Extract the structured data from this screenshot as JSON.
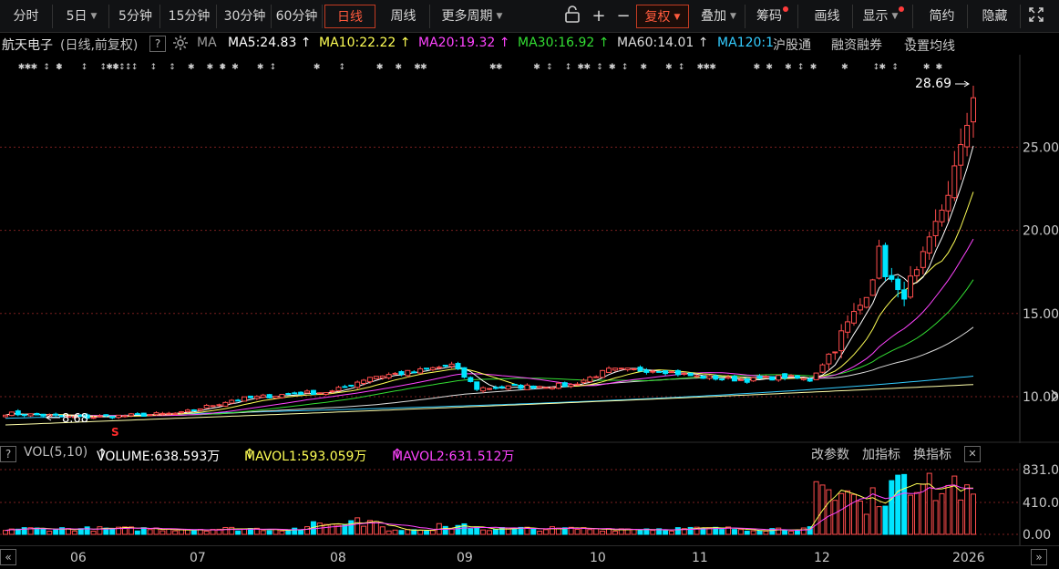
{
  "toolbar": {
    "periods": [
      "分时",
      "5日",
      "5分钟",
      "15分钟",
      "30分钟",
      "60分钟",
      "日线",
      "周线",
      "更多周期"
    ],
    "active_period": "日线",
    "lock_icon": "lock-icon",
    "plus": "+",
    "minus": "−",
    "fuquan": "复权",
    "diejia": "叠加",
    "chouma": "筹码",
    "huaxian": "画线",
    "xianshi": "显示",
    "jianyue": "简约",
    "yincang": "隐藏",
    "fullscreen_icon": "fullscreen-icon"
  },
  "info": {
    "stock_name": "航天电子",
    "mode": "(日线,前复权)",
    "help": "?",
    "gear_icon": "gear-icon",
    "ma_label": "MA",
    "ma": [
      {
        "text": "MA5:24.83",
        "color": "#ffffff"
      },
      {
        "text": "MA10:22.22",
        "color": "#ffff55"
      },
      {
        "text": "MA20:19.32",
        "color": "#ff44ff"
      },
      {
        "text": "MA30:16.92",
        "color": "#33dd33"
      },
      {
        "text": "MA60:14.01",
        "color": "#dddddd"
      },
      {
        "text": "MA120:1",
        "color": "#33ccff"
      }
    ],
    "arrow": "↑",
    "hgt": "沪股通",
    "rzrq": "融资融券",
    "settings": "设置均线"
  },
  "price_axis": {
    "ticks": [
      "25.00",
      "20.00",
      "15.00",
      "10.00"
    ],
    "max_label": "28.69",
    "min_label": "8.68",
    "s_marker": "S"
  },
  "volume": {
    "label": "VOL(5,10)",
    "volume": "VOLUME:638.593万",
    "mavol1": "MAVOL1:593.059万",
    "mavol2": "MAVOL2:631.512万",
    "arrow": "↑",
    "gai_canshu": "改参数",
    "jia_zhibiao": "加指标",
    "huan_zhibiao": "换指标",
    "close": "✕",
    "help": "?",
    "ticks": [
      "831.00",
      "410.00",
      "0.00"
    ]
  },
  "xaxis": {
    "labels": [
      "06",
      "07",
      "08",
      "09",
      "10",
      "11",
      "12",
      "2026"
    ],
    "right_icon": "»"
  },
  "colors": {
    "up": "#ff4d4d",
    "down": "#00e5ff",
    "grid": "#7a1f1f",
    "ma5": "#ffffff",
    "ma10": "#ffff55",
    "ma20": "#ff44ff",
    "ma30": "#33dd33",
    "ma60": "#dddddd",
    "ma120": "#33ccff"
  },
  "chart_data": {
    "type": "candlestick",
    "yticks": [
      10,
      15,
      20,
      25
    ],
    "max": 28.69,
    "min": 8.68,
    "months": [
      "06",
      "07",
      "08",
      "09",
      "10",
      "11",
      "12",
      "2026"
    ],
    "volume_ticks": [
      0,
      410,
      831
    ]
  }
}
